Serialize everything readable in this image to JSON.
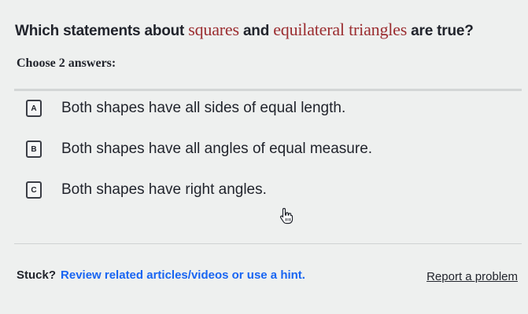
{
  "question": {
    "part1": "Which statements about ",
    "term1": "squares",
    "part2": " and ",
    "term2": "equilateral triangles",
    "part3": " are true?"
  },
  "instructions": "Choose 2 answers:",
  "choices": [
    {
      "letter": "A",
      "text": "Both shapes have all sides of equal length."
    },
    {
      "letter": "B",
      "text": "Both shapes have all angles of equal measure."
    },
    {
      "letter": "C",
      "text": "Both shapes have right angles."
    }
  ],
  "help": {
    "stuck_label": "Stuck?",
    "hint_text": "Review related articles/videos or use a hint."
  },
  "report_link": "Report a problem",
  "colors": {
    "term_color": "#9b2d30",
    "link_color": "#1865f2",
    "background": "#eef0ef"
  },
  "icons": {
    "cursor": "hand-pointer-icon"
  }
}
